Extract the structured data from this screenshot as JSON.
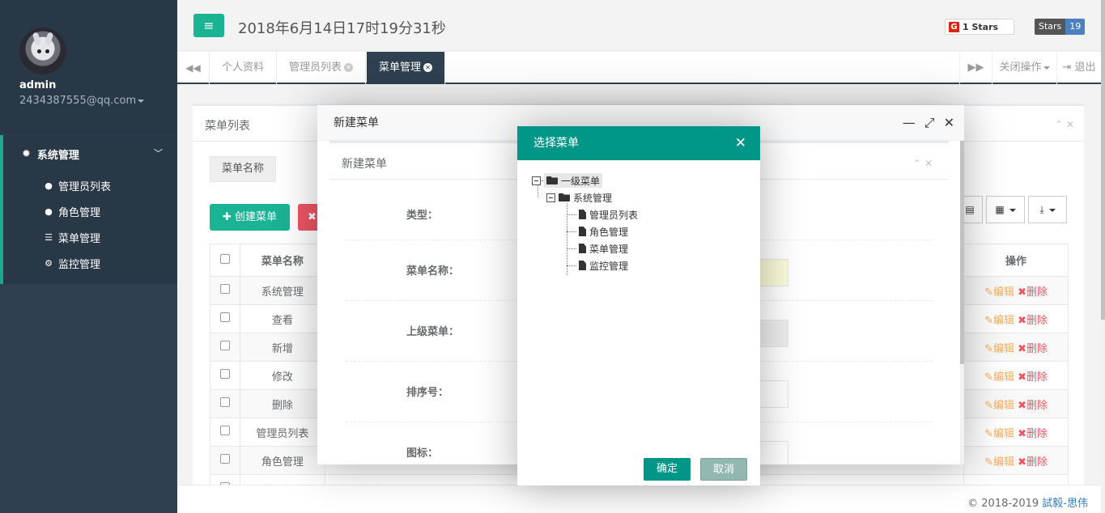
{
  "sidebar": {
    "user_name": "admin",
    "user_email": "2434387555@qq.com",
    "section_title": "系统管理",
    "items": [
      {
        "label": "管理员列表",
        "icon": "user-icon"
      },
      {
        "label": "角色管理",
        "icon": "user-secret-icon"
      },
      {
        "label": "菜单管理",
        "icon": "list-icon"
      },
      {
        "label": "监控管理",
        "icon": "cogs-icon"
      }
    ]
  },
  "header": {
    "datetime": "2018年6月14日17时19分31秒",
    "gitee_stars": "1 Stars",
    "gitee_logo": "G",
    "github_stars_label": "Stars",
    "github_stars_count": "19"
  },
  "tabs": {
    "items": [
      {
        "label": "个人资料"
      },
      {
        "label": "管理员列表"
      },
      {
        "label": "菜单管理"
      }
    ],
    "close_ops": "关闭操作",
    "logout": "退出"
  },
  "content": {
    "title": "菜单列表",
    "search_label": "菜单名称",
    "create_button": "创建菜单",
    "table": {
      "col_name": "菜单名称",
      "col_actions": "操作",
      "rows": [
        "系统管理",
        "查看",
        "新增",
        "修改",
        "删除",
        "管理员列表",
        "角色管理",
        "菜单管理"
      ],
      "edit_label": "编辑",
      "delete_label": "删除",
      "partial_parent": "系统管理"
    }
  },
  "dialog1": {
    "title": "新建菜单",
    "inner_title": "新建菜单",
    "labels": {
      "type": "类型：",
      "name": "菜单名称：",
      "parent": "上级菜单：",
      "order": "排序号：",
      "icon": "图标："
    }
  },
  "dialog2": {
    "title": "选择菜单",
    "tree": {
      "root": "一级菜单",
      "child": "系统管理",
      "leaves": [
        "管理员列表",
        "角色管理",
        "菜单管理",
        "监控管理"
      ]
    },
    "ok": "确定",
    "cancel": "取消"
  },
  "footer": {
    "copyright": "© 2018-2019",
    "author": "試毅-思伟"
  },
  "colors": {
    "sidebar_bg": "#2f4050",
    "primary_green": "#1ab394",
    "dialog_teal": "#009688",
    "danger": "#ed5565",
    "warning": "#f8ac59"
  }
}
